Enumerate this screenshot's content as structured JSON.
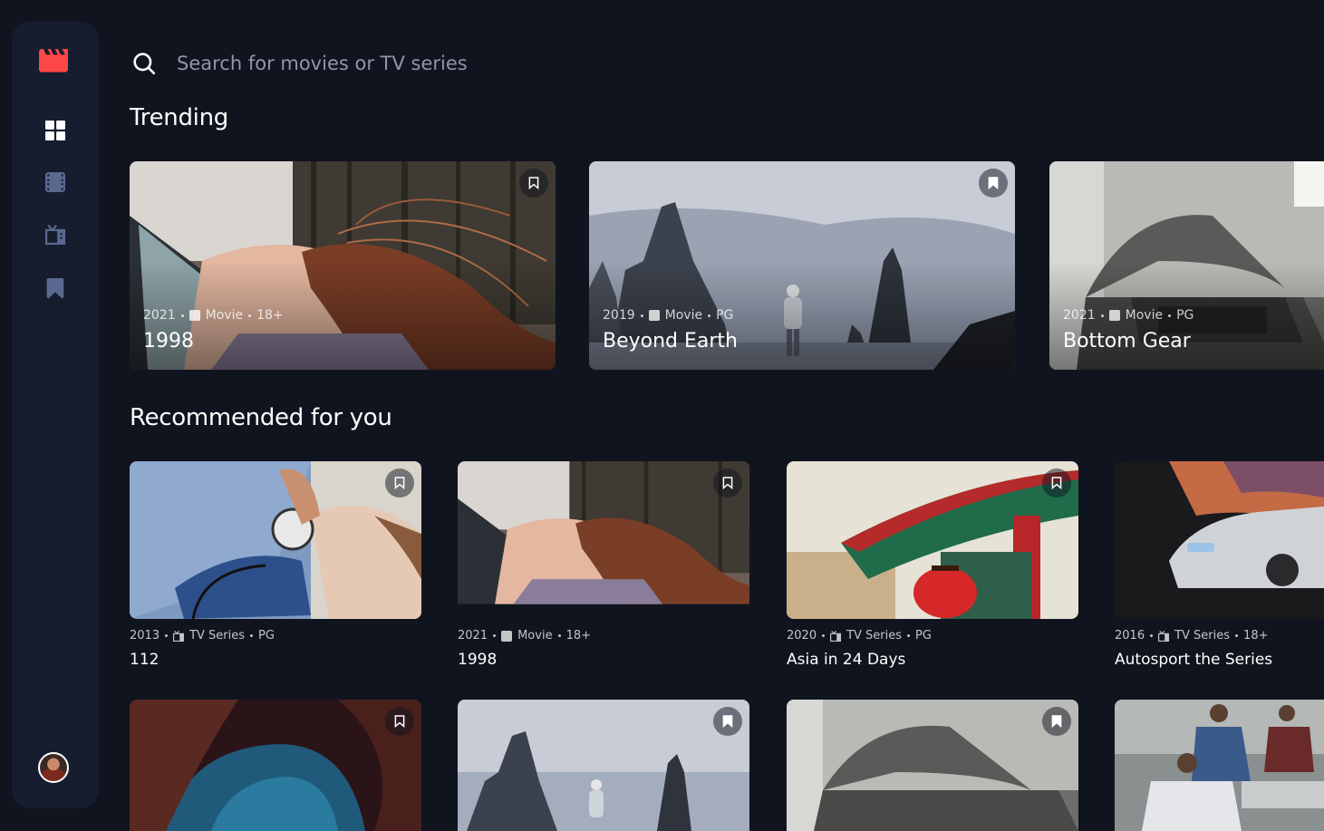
{
  "search": {
    "placeholder": "Search for movies or TV series"
  },
  "sidebar": {
    "items": [
      {
        "name": "home",
        "icon": "grid-icon",
        "active": true
      },
      {
        "name": "movies",
        "icon": "film-icon"
      },
      {
        "name": "tv-series",
        "icon": "tv-icon"
      },
      {
        "name": "bookmarks",
        "icon": "bookmark-icon"
      }
    ]
  },
  "colors": {
    "accent": "#fc4747",
    "background": "#10141e",
    "surface": "#161d2f",
    "muted": "#5a698f"
  },
  "sections": {
    "trending": "Trending",
    "recommended": "Recommended for you"
  },
  "trending": [
    {
      "year": "2021",
      "category": "Movie",
      "rating": "18+",
      "title": "1998"
    },
    {
      "year": "2019",
      "category": "Movie",
      "rating": "PG",
      "title": "Beyond Earth"
    },
    {
      "year": "2021",
      "category": "Movie",
      "rating": "PG",
      "title": "Bottom Gear"
    }
  ],
  "recommended": [
    {
      "year": "2013",
      "category": "TV Series",
      "rating": "PG",
      "title": "112"
    },
    {
      "year": "2021",
      "category": "Movie",
      "rating": "18+",
      "title": "1998"
    },
    {
      "year": "2020",
      "category": "TV Series",
      "rating": "PG",
      "title": "Asia in 24 Days"
    },
    {
      "year": "2016",
      "category": "TV Series",
      "rating": "18+",
      "title": "Autosport the Series"
    }
  ]
}
